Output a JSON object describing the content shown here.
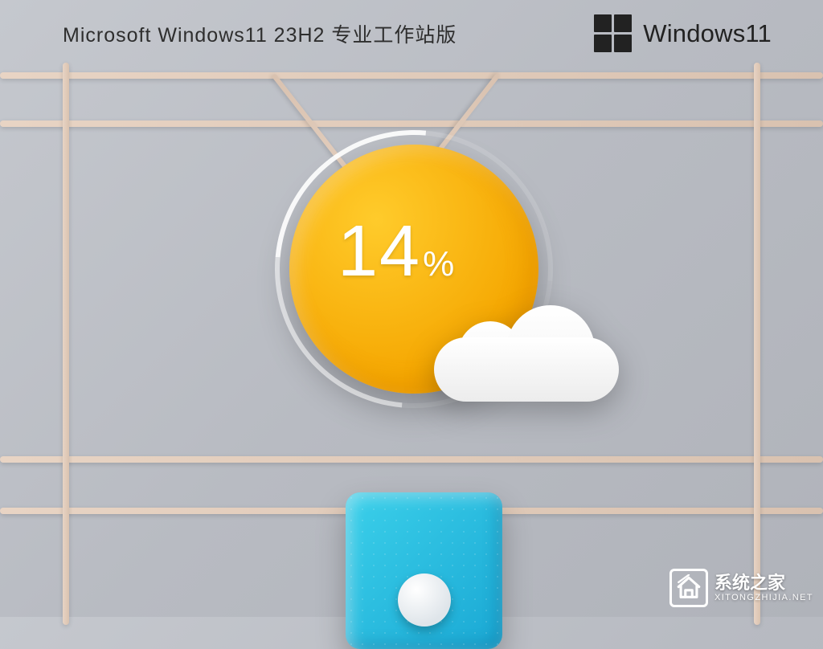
{
  "header": {
    "title": "Microsoft Windows11 23H2 专业工作站版"
  },
  "brand": {
    "text": "Windows",
    "version_suffix": "11"
  },
  "weather_widget": {
    "progress_value": "14",
    "progress_unit": "%"
  },
  "watermark": {
    "title": "系统之家",
    "url": "XITONGZHIJIA.NET"
  },
  "colors": {
    "sun": "#f5a600",
    "glass": "#1aa8d4",
    "frame": "#e8d4c4",
    "text_dark": "#2e2e2e"
  }
}
